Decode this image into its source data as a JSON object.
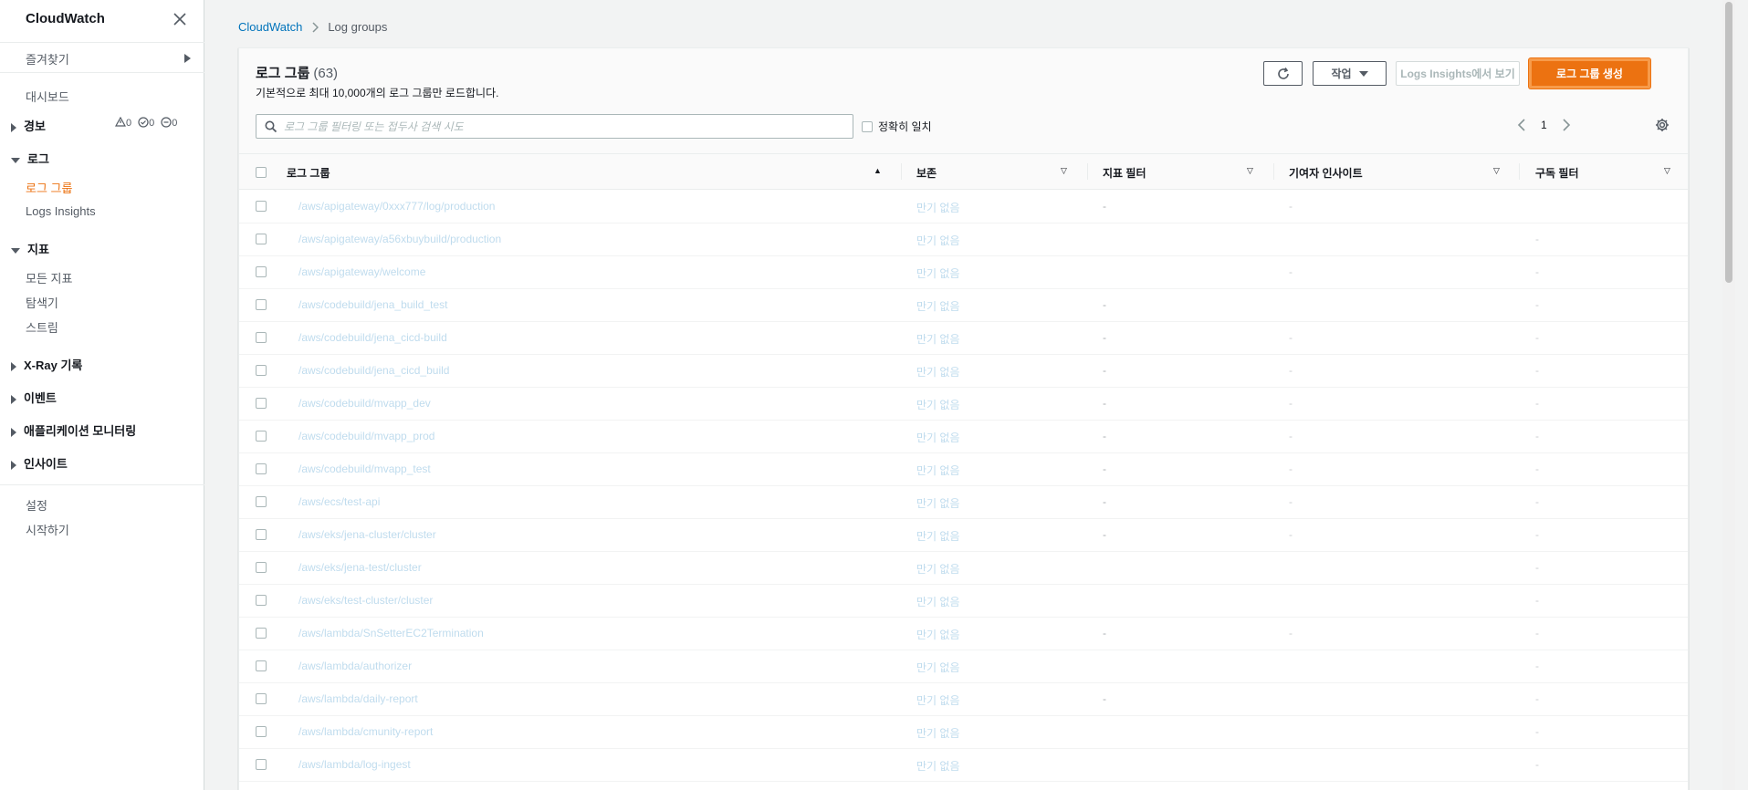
{
  "sidebar": {
    "title": "CloudWatch",
    "favorites": "즐겨찾기",
    "dashboard": "대시보드",
    "alarms": {
      "label": "경보",
      "counts": [
        "0",
        "0",
        "0"
      ]
    },
    "logs": {
      "label": "로그",
      "items": [
        "로그 그룹",
        "Logs Insights"
      ]
    },
    "metrics": {
      "label": "지표",
      "items": [
        "모든 지표",
        "탐색기",
        "스트림"
      ]
    },
    "xray": "X-Ray 기록",
    "events": "이벤트",
    "app_monitoring": "애플리케이션 모니터링",
    "insights": "인사이트",
    "settings": "설정",
    "getting_started": "시작하기"
  },
  "breadcrumb": {
    "root": "CloudWatch",
    "current": "Log groups"
  },
  "panel": {
    "title": "로그 그룹",
    "count": "(63)",
    "description": "기본적으로 최대 10,000개의 로그 그룹만 로드합니다.",
    "actions_label": "작업",
    "insights_label": "Logs Insights에서 보기",
    "create_label": "로그 그룹 생성",
    "search_placeholder": "로그 그룹 필터링 또는 접두사 검색 시도",
    "exact_match": "정확히 일치",
    "page": "1"
  },
  "table": {
    "columns": [
      "로그 그룹",
      "보존",
      "지표 필터",
      "기여자 인사이트",
      "구독 필터"
    ],
    "rows": [
      {
        "name": "/aws/apigateway/0xxx777/log/production",
        "retention": "만기 없음",
        "metric": "-",
        "contrib": "-",
        "sub": ""
      },
      {
        "name": "/aws/apigateway/a56xbuybuild/production",
        "retention": "만기 없음",
        "metric": "",
        "contrib": "",
        "sub": "-"
      },
      {
        "name": "/aws/apigateway/welcome",
        "retention": "만기 없음",
        "metric": "",
        "contrib": "-",
        "sub": "-"
      },
      {
        "name": "/aws/codebuild/jena_build_test",
        "retention": "만기 없음",
        "metric": "-",
        "contrib": "",
        "sub": "-"
      },
      {
        "name": "/aws/codebuild/jena_cicd-build",
        "retention": "만기 없음",
        "metric": "-",
        "contrib": "-",
        "sub": "-"
      },
      {
        "name": "/aws/codebuild/jena_cicd_build",
        "retention": "만기 없음",
        "metric": "-",
        "contrib": "-",
        "sub": "-"
      },
      {
        "name": "/aws/codebuild/mvapp_dev",
        "retention": "만기 없음",
        "metric": "-",
        "contrib": "-",
        "sub": "-"
      },
      {
        "name": "/aws/codebuild/mvapp_prod",
        "retention": "만기 없음",
        "metric": "-",
        "contrib": "-",
        "sub": "-"
      },
      {
        "name": "/aws/codebuild/mvapp_test",
        "retention": "만기 없음",
        "metric": "-",
        "contrib": "-",
        "sub": "-"
      },
      {
        "name": "/aws/ecs/test-api",
        "retention": "만기 없음",
        "metric": "-",
        "contrib": "-",
        "sub": "-"
      },
      {
        "name": "/aws/eks/jena-cluster/cluster",
        "retention": "만기 없음",
        "metric": "-",
        "contrib": "-",
        "sub": "-"
      },
      {
        "name": "/aws/eks/jena-test/cluster",
        "retention": "만기 없음",
        "metric": "",
        "contrib": "",
        "sub": "-"
      },
      {
        "name": "/aws/eks/test-cluster/cluster",
        "retention": "만기 없음",
        "metric": "",
        "contrib": "",
        "sub": "-"
      },
      {
        "name": "/aws/lambda/SnSetterEC2Termination",
        "retention": "만기 없음",
        "metric": "-",
        "contrib": "-",
        "sub": "-"
      },
      {
        "name": "/aws/lambda/authorizer",
        "retention": "만기 없음",
        "metric": "",
        "contrib": "",
        "sub": "-"
      },
      {
        "name": "/aws/lambda/daily-report",
        "retention": "만기 없음",
        "metric": "-",
        "contrib": "",
        "sub": "-"
      },
      {
        "name": "/aws/lambda/cmunity-report",
        "retention": "만기 없음",
        "metric": "",
        "contrib": "",
        "sub": "-"
      },
      {
        "name": "/aws/lambda/log-ingest",
        "retention": "만기 없음",
        "metric": "",
        "contrib": "",
        "sub": "-"
      }
    ]
  }
}
